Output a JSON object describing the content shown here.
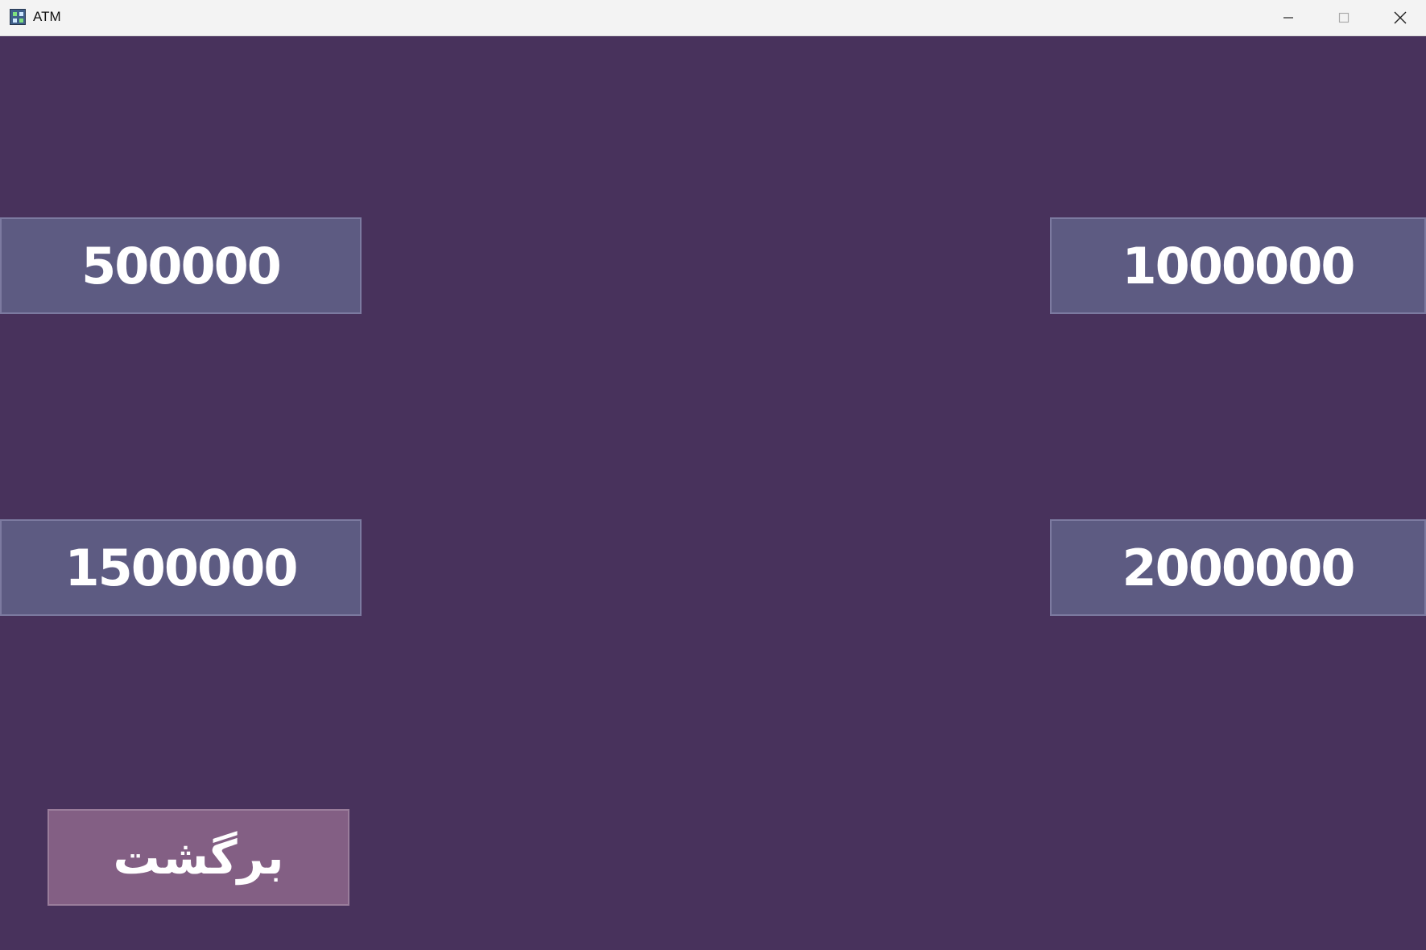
{
  "window": {
    "title": "ATM",
    "icon": "atm-app-icon",
    "controls": {
      "minimize": "minimize-icon",
      "maximize": "maximize-icon",
      "close": "close-icon"
    }
  },
  "amounts": {
    "top_left": "500000",
    "top_right": "1000000",
    "middle_left": "1500000",
    "middle_right": "2000000"
  },
  "back_label": "برگشت",
  "colors": {
    "background": "#48325c",
    "amount_button": "#5d5b82",
    "back_button": "#835f84",
    "text": "#ffffff"
  }
}
